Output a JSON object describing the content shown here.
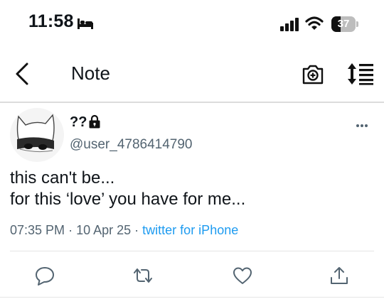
{
  "status_bar": {
    "time": "11:58",
    "battery_percent": "37",
    "battery_level": 0.37,
    "icons": [
      "bed-icon",
      "signal-icon",
      "wifi-icon",
      "battery-icon"
    ]
  },
  "nav": {
    "title": "Note",
    "icons": [
      "chevron-left-icon",
      "camera-plus-icon",
      "sort-icon"
    ]
  },
  "tweet": {
    "display_name": "??",
    "handle": "@user_4786414790",
    "text_lines": [
      "this can't be...",
      "for this ‘love’ you have for me..."
    ],
    "time": "07:35 PM",
    "date": "10 Apr 25",
    "separator": "·",
    "source": "twitter for iPhone",
    "actions": [
      "reply-icon",
      "retweet-icon",
      "like-icon",
      "share-icon"
    ]
  },
  "colors": {
    "text": "#0f1419",
    "secondary": "#536471",
    "link": "#1d9bf0",
    "divider": "#dcdcdc"
  }
}
